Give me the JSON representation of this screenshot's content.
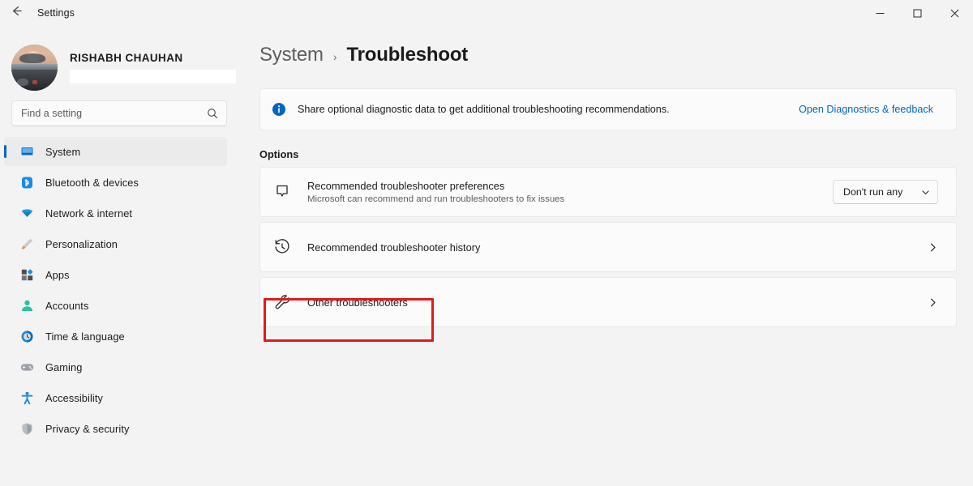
{
  "titlebar": {
    "back_icon": "arrow-left-icon",
    "app_title": "Settings",
    "minimize_label": "–",
    "maximize_label": "□",
    "close_label": "✕"
  },
  "sidebar": {
    "profile": {
      "name": "RISHABH CHAUHAN",
      "avatar_icon": "user-avatar-photo",
      "redacted_field": ""
    },
    "search": {
      "placeholder": "Find a setting",
      "value": "",
      "icon": "search-icon"
    },
    "items": [
      {
        "label": "System",
        "icon": "monitor-icon",
        "selected": true
      },
      {
        "label": "Bluetooth & devices",
        "icon": "bluetooth-icon",
        "selected": false
      },
      {
        "label": "Network & internet",
        "icon": "wifi-icon",
        "selected": false
      },
      {
        "label": "Personalization",
        "icon": "paintbrush-icon",
        "selected": false
      },
      {
        "label": "Apps",
        "icon": "apps-grid-icon",
        "selected": false
      },
      {
        "label": "Accounts",
        "icon": "person-icon",
        "selected": false
      },
      {
        "label": "Time & language",
        "icon": "clock-globe-icon",
        "selected": false
      },
      {
        "label": "Gaming",
        "icon": "gamepad-icon",
        "selected": false
      },
      {
        "label": "Accessibility",
        "icon": "accessibility-person-icon",
        "selected": false
      },
      {
        "label": "Privacy & security",
        "icon": "shield-icon",
        "selected": false
      }
    ]
  },
  "main": {
    "breadcrumb": {
      "parent": "System",
      "separator": "›",
      "current": "Troubleshoot"
    },
    "banner": {
      "icon": "info-icon",
      "text": "Share optional diagnostic data to get additional troubleshooting recommendations.",
      "link_label": "Open Diagnostics & feedback"
    },
    "section_title": "Options",
    "cards": [
      {
        "icon": "feedback-bubble-icon",
        "title": "Recommended troubleshooter preferences",
        "subtitle": "Microsoft can recommend and run troubleshooters to fix issues",
        "control": "dropdown",
        "dropdown_value": "Don't run any"
      },
      {
        "icon": "history-clock-icon",
        "title": "Recommended troubleshooter history",
        "subtitle": "",
        "control": "chevron"
      },
      {
        "icon": "wrench-icon",
        "title": "Other troubleshooters",
        "subtitle": "",
        "control": "chevron"
      }
    ],
    "highlight": {
      "target": "Other troubleshooters",
      "color": "#e01b1b"
    }
  },
  "colors": {
    "accent": "#0067c0",
    "page_background": "#f3f3f3",
    "card_background": "#fbfbfb",
    "highlight": "#e01b1b"
  }
}
